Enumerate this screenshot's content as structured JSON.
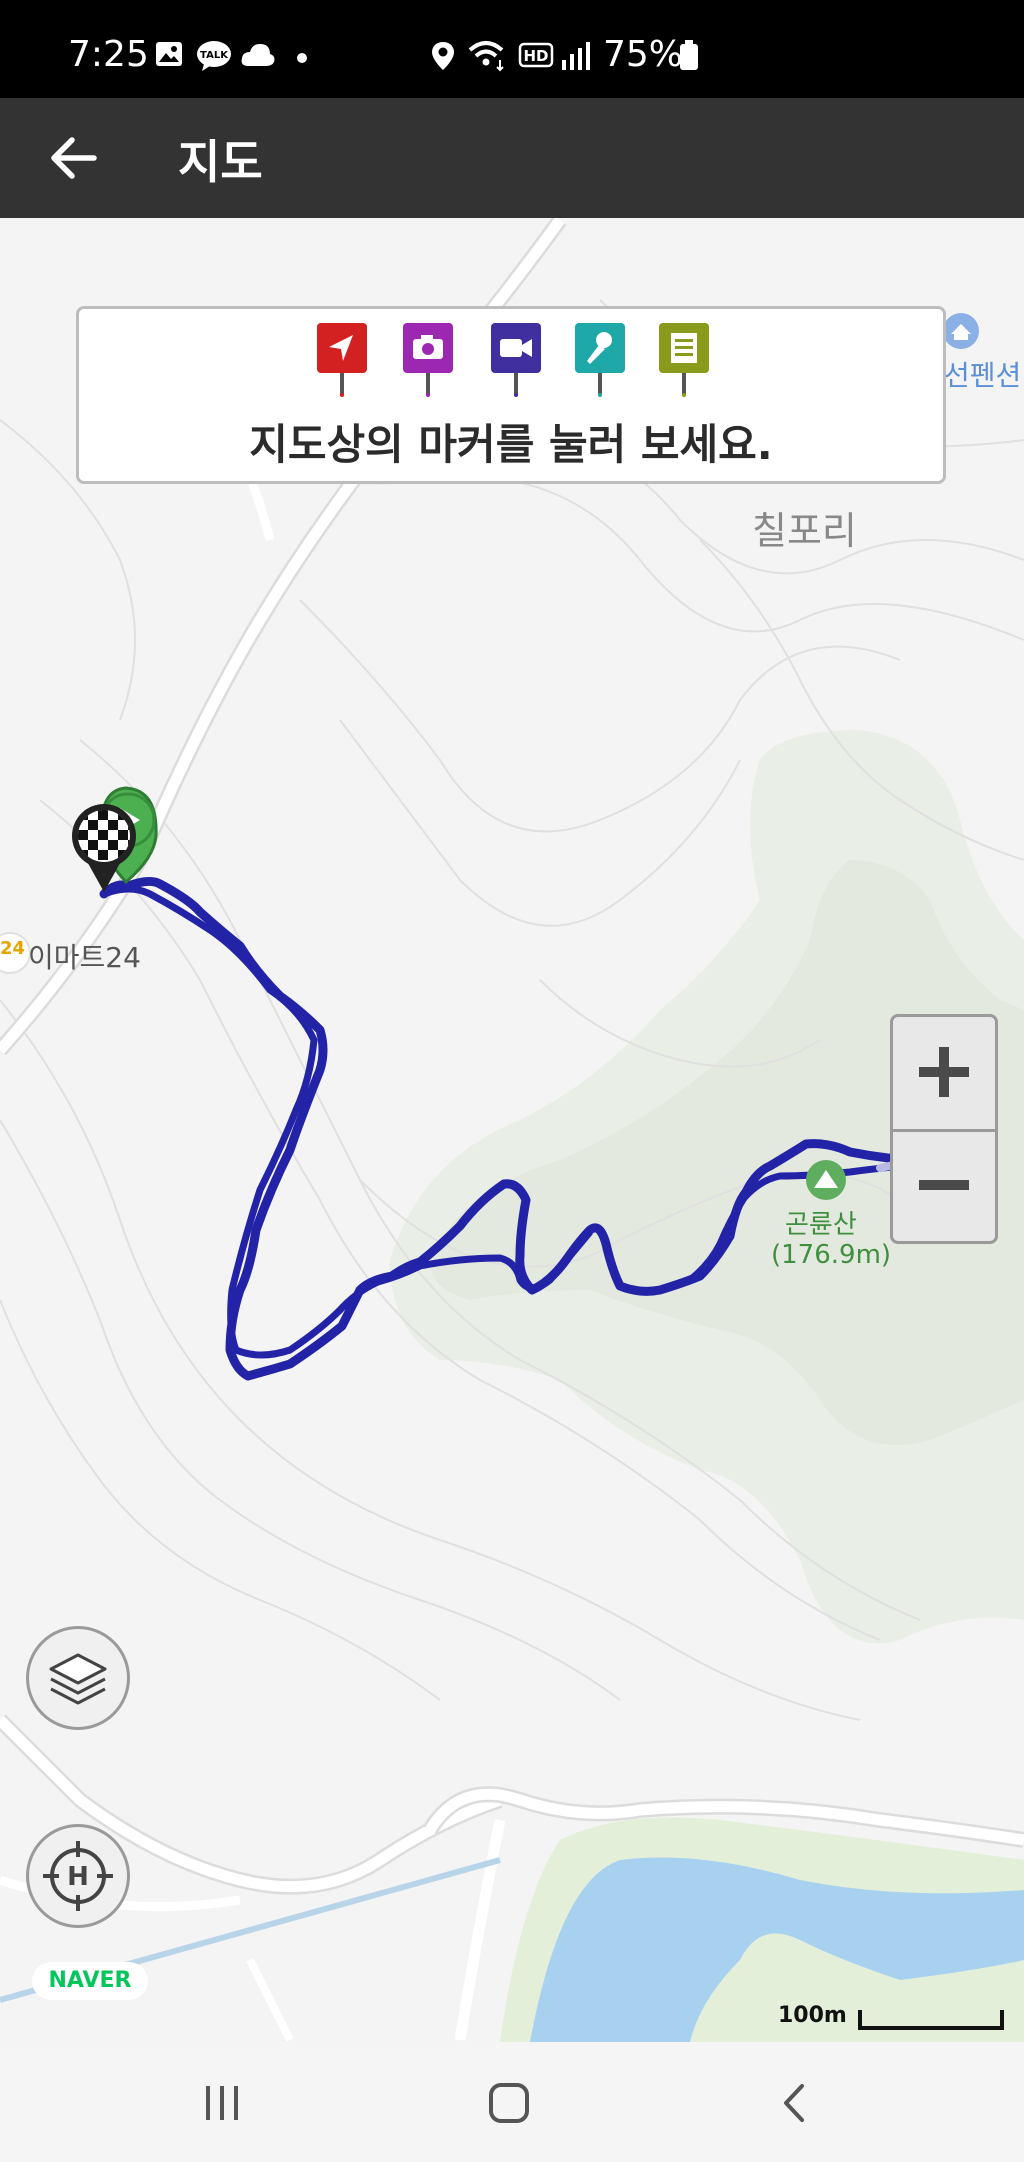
{
  "status_bar": {
    "time": "7:25",
    "battery": "75%",
    "icons": [
      "gallery-icon",
      "kakaotalk-icon",
      "cloud-icon",
      "dot-icon",
      "location-icon",
      "wifi-icon",
      "hd-icon",
      "signal-icon",
      "battery-icon"
    ]
  },
  "app_bar": {
    "back_icon": "arrow-left-icon",
    "title": "지도"
  },
  "info_box": {
    "hint": "지도상의 마커를 눌러 보세요.",
    "markers": [
      {
        "name": "navigation-marker",
        "color": "#d32020"
      },
      {
        "name": "camera-marker",
        "color": "#9c27b0"
      },
      {
        "name": "video-marker",
        "color": "#3f2f9f"
      },
      {
        "name": "microphone-marker",
        "color": "#1fa8a8"
      },
      {
        "name": "memo-marker",
        "color": "#8a9a1a"
      }
    ]
  },
  "map": {
    "labels": {
      "village": "칠포리",
      "store": "이마트24",
      "store_badge": "24",
      "mountain_name": "곤륜산",
      "mountain_height": "(176.9m)",
      "pension": "선펜션"
    },
    "track_color": "#2323a8",
    "zoom_in_icon": "plus-icon",
    "zoom_out_icon": "minus-icon",
    "layers_icon": "layers-icon",
    "locate_icon": "crosshair-h-icon",
    "attribution": "NAVER",
    "scale_label": "100m"
  },
  "nav_bar": {
    "recents_icon": "recents-icon",
    "home_icon": "home-icon",
    "back_icon": "back-chevron-icon"
  }
}
